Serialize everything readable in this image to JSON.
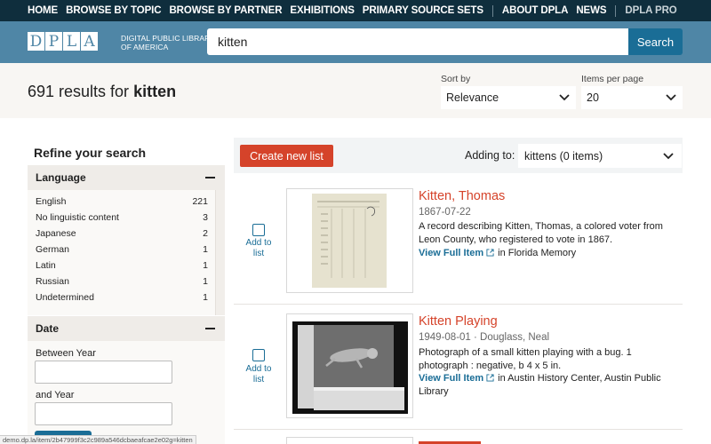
{
  "nav": {
    "items": [
      "HOME",
      "BROWSE BY TOPIC",
      "BROWSE BY PARTNER",
      "EXHIBITIONS",
      "PRIMARY SOURCE SETS"
    ],
    "secondary": [
      "ABOUT DPLA",
      "NEWS"
    ],
    "pro": "DPLA PRO"
  },
  "header": {
    "logo_letters": [
      "D",
      "P",
      "L",
      "A"
    ],
    "logo_text_line1": "DIGITAL PUBLIC LIBRARY",
    "logo_text_line2": "OF AMERICA",
    "search_value": "kitten",
    "search_button": "Search"
  },
  "results": {
    "count_prefix": "691 results for ",
    "query": "kitten",
    "sort_label": "Sort by",
    "sort_value": "Relevance",
    "per_page_label": "Items per page",
    "per_page_value": "20"
  },
  "sidebar": {
    "title": "Refine your search",
    "language": {
      "heading": "Language",
      "items": [
        {
          "label": "English",
          "count": "221"
        },
        {
          "label": "No linguistic content",
          "count": "3"
        },
        {
          "label": "Japanese",
          "count": "2"
        },
        {
          "label": "German",
          "count": "1"
        },
        {
          "label": "Latin",
          "count": "1"
        },
        {
          "label": "Russian",
          "count": "1"
        },
        {
          "label": "Undetermined",
          "count": "1"
        }
      ]
    },
    "date": {
      "heading": "Date",
      "between_label": "Between Year",
      "and_label": "and Year"
    }
  },
  "list_bar": {
    "create_button": "Create new list",
    "adding_label": "Adding to:",
    "list_value": "kittens (0 items)"
  },
  "items": [
    {
      "add_label_1": "Add to",
      "add_label_2": "list",
      "title": "Kitten, Thomas",
      "meta": "1867-07-22",
      "description": "A record describing Kitten, Thomas, a colored voter from Leon County, who registered to vote in 1867.",
      "link_label": "View Full Item",
      "source": "in Florida Memory"
    },
    {
      "add_label_1": "Add to",
      "add_label_2": "list",
      "title": "Kitten Playing",
      "meta": "1949-08-01 · Douglass, Neal",
      "description": "Photograph of a small kitten playing with a bug. 1 photograph : negative, b 4 x 5 in.",
      "link_label": "View Full Item",
      "source": "in Austin History Center, Austin Public Library"
    }
  ],
  "status_url": "demo.dp.la/item/2b47999f3c2c989a546dcbaeafcae2e02g=kitten",
  "colors": {
    "nav_bg": "#0f2e3d",
    "header_bg": "#4f86a6",
    "accent_blue": "#1a6d96",
    "accent_red": "#d5432a"
  }
}
